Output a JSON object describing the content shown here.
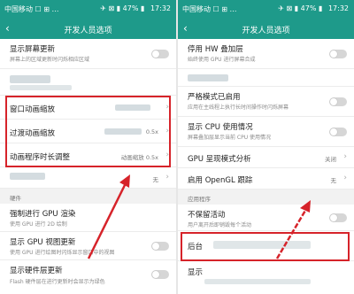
{
  "colors": {
    "accent": "#1e9a8a",
    "highlight": "#d6232a"
  },
  "left": {
    "status": {
      "carrier": "中国移动 ☐ ⊞ …",
      "signal": "✈ ⊠ ▮ 47% ▮",
      "time": "17:32"
    },
    "title": "开发人员选项",
    "rows": [
      {
        "title": "显示屏幕更新",
        "subtitle": "屏幕上的区域更新时闪烁相应区域"
      },
      {
        "title": "窗口动画缩放",
        "value": ""
      },
      {
        "title": "过渡动画缩放",
        "value": "0.5x"
      },
      {
        "title": "动画程序时长调整",
        "value": "动画缩放 0.5x"
      },
      {
        "value": "无"
      },
      {
        "title": "强制进行 GPU 渲染",
        "subtitle": "使用 GPU 进行 2D 绘制"
      },
      {
        "title": "显示 GPU 视图更新",
        "subtitle": "使用 GPU 进行绘图时闪烁显示窗口中的视图"
      },
      {
        "title": "显示硬件层更新",
        "subtitle": "Flash 硬件层在进行更新时会显示为绿色"
      }
    ],
    "section": "硬件"
  },
  "right": {
    "status": {
      "carrier": "中国移动 ☐ ⊞ …",
      "signal": "✈ ⊠ ▮ 47% ▮",
      "time": "17:32"
    },
    "title": "开发人员选项",
    "rows": [
      {
        "title": "停用 HW 叠加层",
        "subtitle": "始终使用 GPU 进行屏幕合成"
      },
      {
        "title": "严格模式已启用",
        "subtitle": "应用在主线程上执行长时间操作时闪烁屏幕"
      },
      {
        "title": "显示 CPU 使用情况",
        "subtitle": "屏幕叠加层显示当前 CPU 使用情况"
      },
      {
        "title": "GPU 呈现模式分析",
        "value": "关闭"
      },
      {
        "title": "启用 OpenGL 跟踪",
        "value": "无"
      },
      {
        "title": "不保留活动",
        "subtitle": "用户离开后即销毁每个活动"
      },
      {
        "title": "后台"
      },
      {
        "title": "显示"
      }
    ],
    "section": "应用程序"
  }
}
